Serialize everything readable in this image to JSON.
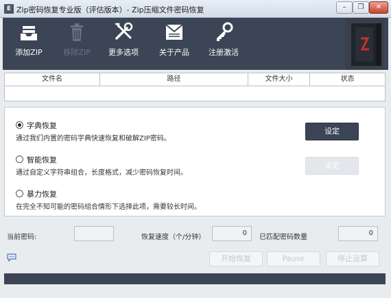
{
  "window": {
    "title": "Zip密码恢复专业版（评估版本）- Zip压缩文件密码恢复",
    "app_icon_letter": "E",
    "min_glyph": "–",
    "max_glyph": "❐",
    "close_glyph": "✕"
  },
  "toolbar": {
    "items": [
      {
        "label": "添加ZIP",
        "icon": "tray-icon"
      },
      {
        "label": "移除ZIP",
        "icon": "trash-icon"
      },
      {
        "label": "更多选项",
        "icon": "tools-icon"
      },
      {
        "label": "关于产品",
        "icon": "mail-icon"
      },
      {
        "label": "注册激活",
        "icon": "key-icon"
      }
    ]
  },
  "file_table": {
    "columns": [
      "文件名",
      "路径",
      "文件大小",
      "状态"
    ]
  },
  "modes": [
    {
      "label": "字典恢复",
      "desc": "通过我们内置的密码字典快速恢复和破解ZIP密码。",
      "checked": true,
      "button": "设定"
    },
    {
      "label": "智能恢复",
      "desc": "通过自定义字符串组合，长度格式，减少密码恢复时间。",
      "checked": false,
      "button": "设定"
    },
    {
      "label": "暴力恢复",
      "desc": "在完全不知可能的密码组合情形下选择此项，需要较长时间。",
      "checked": false
    }
  ],
  "stats": {
    "current_password_label": "当前密码:",
    "current_password": "",
    "speed_label": "恢复速度（个/分钟）",
    "speed": "0",
    "matched_label": "已匹配密码数量",
    "matched": "0"
  },
  "actions": {
    "start": "开始恢复",
    "pause": "Pause",
    "stop": "停止运算"
  },
  "colors": {
    "toolbar_bg": "#3c4556",
    "accent_button": "#3c4556"
  }
}
